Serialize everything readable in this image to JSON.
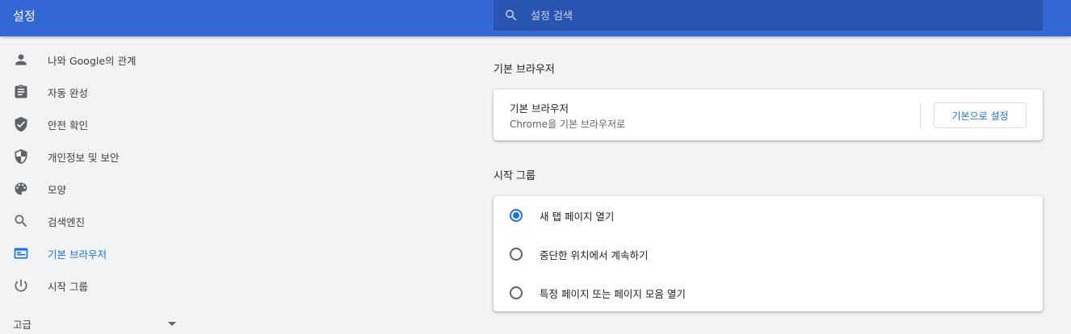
{
  "header": {
    "title": "설정",
    "search_placeholder": "설정 검색"
  },
  "sidebar": {
    "items": [
      {
        "label": "나와 Google의 관계",
        "icon": "person-icon"
      },
      {
        "label": "자동 완성",
        "icon": "clipboard-icon"
      },
      {
        "label": "안전 확인",
        "icon": "shield-check-icon"
      },
      {
        "label": "개인정보 및 보안",
        "icon": "shield-half-icon"
      },
      {
        "label": "모양",
        "icon": "palette-icon"
      },
      {
        "label": "검색엔진",
        "icon": "search-icon"
      },
      {
        "label": "기본 브라우저",
        "icon": "browser-window-icon",
        "active": true
      },
      {
        "label": "시작 그룹",
        "icon": "power-icon"
      }
    ],
    "advanced_label": "고급"
  },
  "default_browser": {
    "section_title": "기본 브라우저",
    "row_title": "기본 브라우저",
    "row_subtitle": "Chrome을 기본 브라우저로",
    "button_label": "기본으로 설정"
  },
  "startup": {
    "section_title": "시작 그룹",
    "options": [
      {
        "label": "새 탭 페이지 열기",
        "checked": true
      },
      {
        "label": "중단한 위치에서 계속하기",
        "checked": false
      },
      {
        "label": "특정 페이지 또는 페이지 모음 열기",
        "checked": false
      }
    ]
  },
  "colors": {
    "header": "#3367d6",
    "search_box": "#2a54b1",
    "accent": "#1a73e8",
    "background": "#f1f3f4"
  }
}
